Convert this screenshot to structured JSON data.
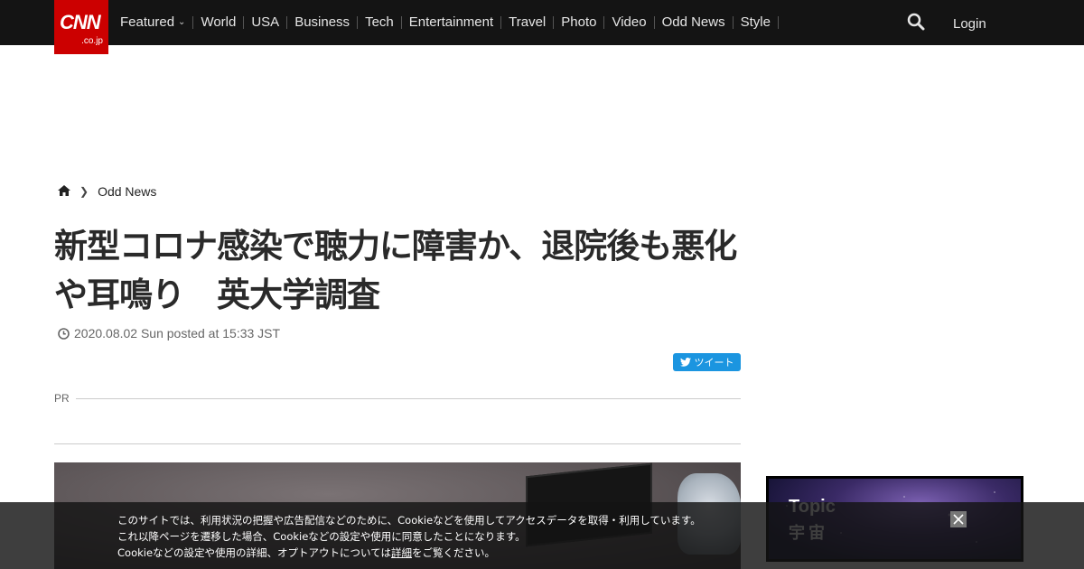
{
  "header": {
    "logo_main": "CNN",
    "logo_sub": ".co.jp",
    "nav": [
      "Featured",
      "World",
      "USA",
      "Business",
      "Tech",
      "Entertainment",
      "Travel",
      "Photo",
      "Video",
      "Odd News",
      "Style"
    ],
    "login_label": "Login"
  },
  "breadcrumb": {
    "section": "Odd News"
  },
  "article": {
    "title": "新型コロナ感染で聴力に障害か、退院後も悪化や耳鳴り　英大学調査",
    "date": "2020.08.02 Sun posted at 15:33 JST",
    "tweet_label": "ツイート",
    "pr_label": "PR"
  },
  "sidebar": {
    "topic_en": "Topic",
    "topic_ja": "宇宙"
  },
  "cookie": {
    "line1": "このサイトでは、利用状況の把握や広告配信などのために、Cookieなどを使用してアクセスデータを取得・利用しています。",
    "line2": "これ以降ページを遷移した場合、Cookieなどの設定や使用に同意したことになります。",
    "line3_pre": "Cookieなどの設定や使用の詳細、オプトアウトについては",
    "line3_link": "詳細",
    "line3_post": "をご覧ください。"
  },
  "colors": {
    "brand_red": "#cc0000",
    "header_bg": "#141414",
    "twitter_blue": "#1b95e0"
  },
  "icons": [
    "home-icon",
    "chevron-right-icon",
    "clock-icon",
    "twitter-icon",
    "search-icon",
    "close-icon",
    "chevron-down-icon"
  ]
}
